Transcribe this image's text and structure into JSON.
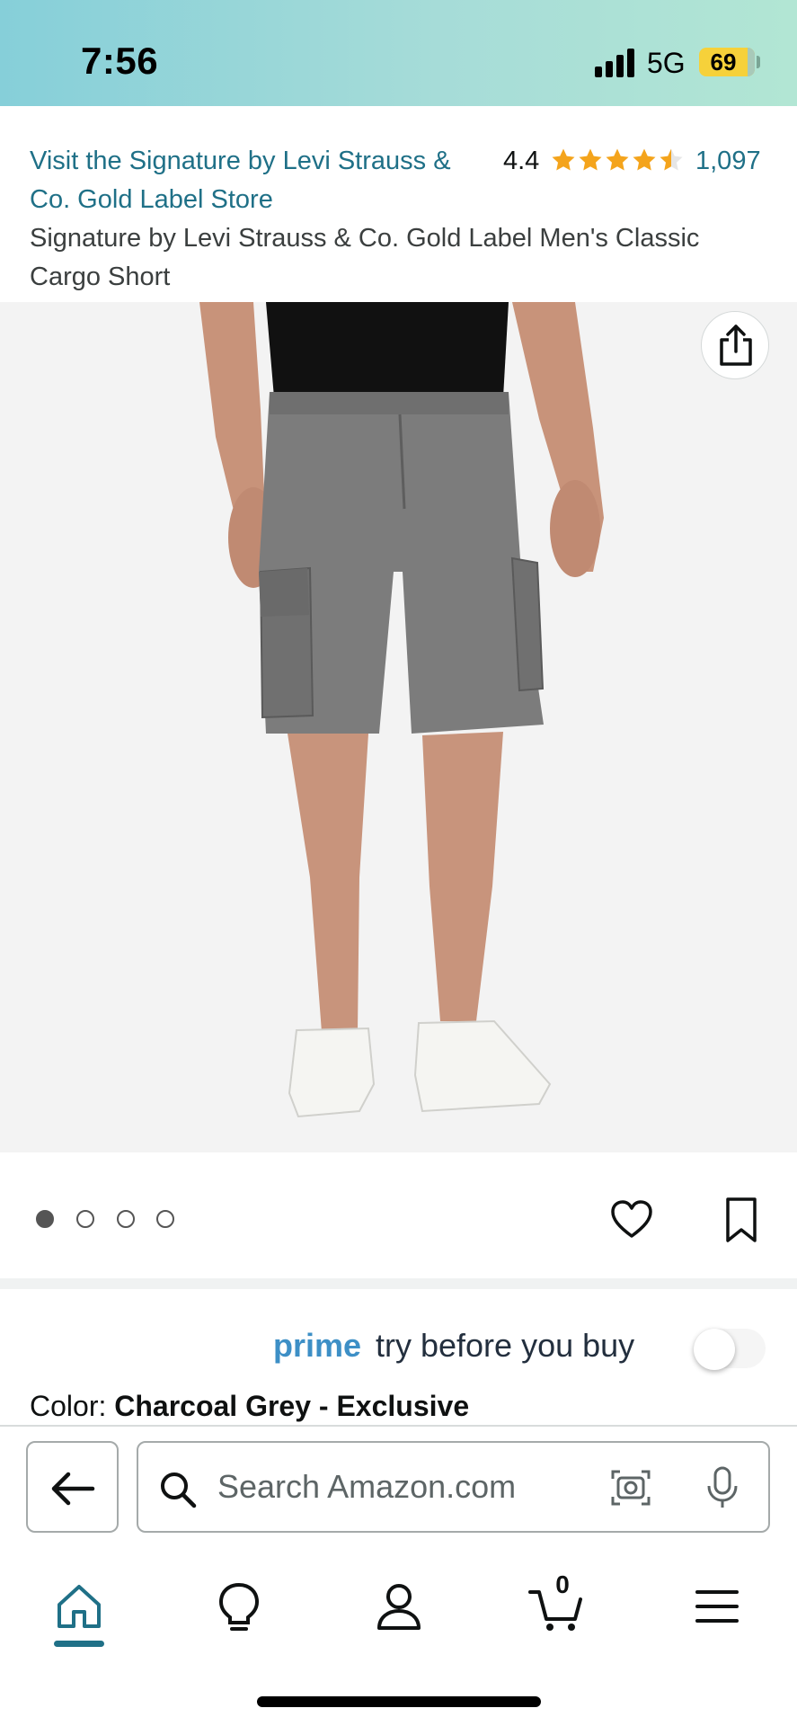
{
  "status_bar": {
    "time": "7:56",
    "network": "5G",
    "battery": "69"
  },
  "header": {
    "store_link": "Visit the Signature by Levi Strauss & Co. Gold Label Store",
    "rating": "4.4",
    "stars": 4.4,
    "review_count": "1,097",
    "product_title": "Signature by Levi Strauss & Co. Gold Label Men's Classic Cargo Short"
  },
  "gallery": {
    "image_count": 4,
    "active_index": 0
  },
  "prime": {
    "brand": "prime",
    "text": "try before you buy",
    "toggle_on": false
  },
  "color": {
    "label": "Color: ",
    "value": "Charcoal Grey - Exclusive"
  },
  "search": {
    "placeholder": "Search Amazon.com"
  },
  "tabs": [
    "home-icon",
    "inspire-icon",
    "account-icon",
    "cart-icon",
    "menu-icon"
  ],
  "cart": {
    "count": "0"
  },
  "colors": {
    "link": "#1f7087",
    "star": "#f4a41c",
    "prime": "#3d8fc6"
  }
}
